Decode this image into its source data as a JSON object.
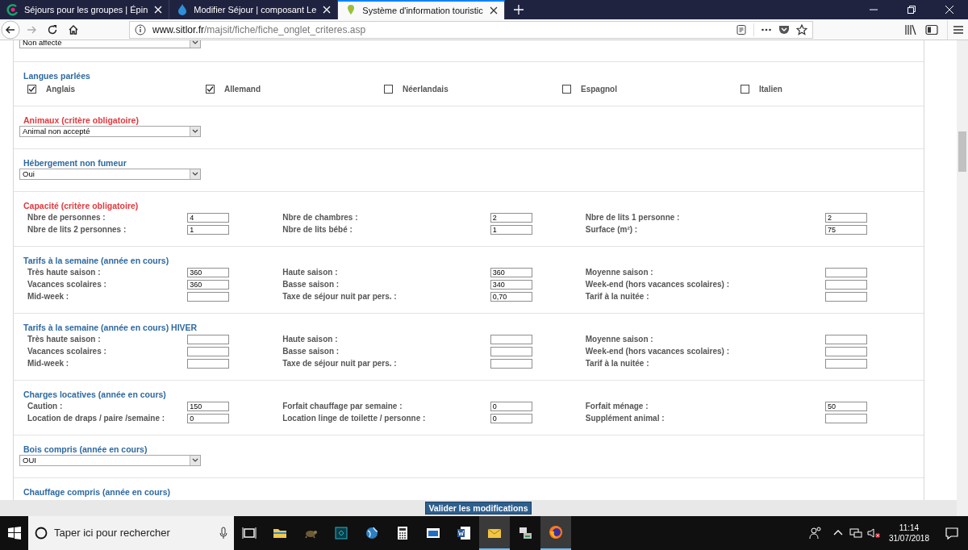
{
  "browser": {
    "tabs": [
      {
        "title": "Séjours pour les groupes | Épin",
        "selected": false
      },
      {
        "title": "Modifier Séjour | composant Le",
        "selected": false
      },
      {
        "title": "Système d'information touristic",
        "selected": true
      }
    ],
    "address": {
      "domain": "www.sitlor.fr",
      "path": "/majsit/fiche/fiche_onglet_criteres.asp"
    }
  },
  "sections": [
    {
      "kind": "select",
      "value": "Non affecté"
    },
    {
      "kind": "checkboxes",
      "title": "Langues parlées",
      "required": false,
      "options": [
        {
          "label": "Anglais",
          "checked": true
        },
        {
          "label": "Allemand",
          "checked": true
        },
        {
          "label": "Néerlandais",
          "checked": false
        },
        {
          "label": "Espagnol",
          "checked": false
        },
        {
          "label": "Italien",
          "checked": false
        }
      ]
    },
    {
      "kind": "select",
      "title": "Animaux (critère obligatoire)",
      "required": true,
      "value": "Animal non accepté"
    },
    {
      "kind": "select",
      "title": "Hébergement non fumeur",
      "required": false,
      "value": "Oui"
    },
    {
      "kind": "fields",
      "title": "Capacité (critère obligatoire)",
      "required": true,
      "rows": [
        [
          {
            "label": "Nbre de personnes :",
            "value": "4"
          },
          {
            "label": "Nbre de chambres :",
            "value": "2"
          },
          {
            "label": "Nbre de lits 1 personne :",
            "value": "2"
          }
        ],
        [
          {
            "label": "Nbre de lits 2 personnes :",
            "value": "1"
          },
          {
            "label": "Nbre de lits bébé :",
            "value": "1"
          },
          {
            "label": "Surface (m²) :",
            "value": "75"
          }
        ]
      ]
    },
    {
      "kind": "fields",
      "title": "Tarifs à la semaine (année en cours)",
      "required": false,
      "rows": [
        [
          {
            "label": "Très haute saison :",
            "value": "360"
          },
          {
            "label": "Haute saison :",
            "value": "360"
          },
          {
            "label": "Moyenne saison :"
          }
        ],
        [
          {
            "label": "Vacances scolaires :",
            "value": "360"
          },
          {
            "label": "Basse saison :",
            "value": "340"
          },
          {
            "label": "Week-end (hors vacances scolaires) :"
          }
        ],
        [
          {
            "label": "Mid-week :"
          },
          {
            "label": "Taxe de séjour nuit par pers. :",
            "value": "0,70"
          },
          {
            "label": "Tarif à la nuitée :"
          }
        ]
      ]
    },
    {
      "kind": "fields",
      "title": "Tarifs à la semaine (année en cours) HIVER",
      "required": false,
      "rows": [
        [
          {
            "label": "Très haute saison :"
          },
          {
            "label": "Haute saison :"
          },
          {
            "label": "Moyenne saison :"
          }
        ],
        [
          {
            "label": "Vacances scolaires :"
          },
          {
            "label": "Basse saison :"
          },
          {
            "label": "Week-end (hors vacances scolaires) :"
          }
        ],
        [
          {
            "label": "Mid-week :"
          },
          {
            "label": "Taxe de séjour nuit par pers. :"
          },
          {
            "label": "Tarif à la nuitée :"
          }
        ]
      ]
    },
    {
      "kind": "fields",
      "title": "Charges locatives (année en cours)",
      "required": false,
      "rows": [
        [
          {
            "label": "Caution :",
            "value": "150"
          },
          {
            "label": "Forfait chauffage par semaine :",
            "value": "0"
          },
          {
            "label": "Forfait ménage :",
            "value": "50"
          }
        ],
        [
          {
            "label": "Location de draps / paire /semaine :",
            "value": "0"
          },
          {
            "label": "Location linge de toilette / personne :",
            "value": "0"
          },
          {
            "label": "Supplément animal :"
          }
        ]
      ]
    },
    {
      "kind": "select",
      "title": "Bois compris (année en cours)",
      "required": false,
      "value": "OUI"
    },
    {
      "kind": "heading",
      "title": "Chauffage compris (année en cours)",
      "required": false
    }
  ],
  "submit": "Valider les modifications",
  "taskbar": {
    "search_placeholder": "Taper ici pour rechercher",
    "time": "11:14",
    "date": "31/07/2018"
  }
}
